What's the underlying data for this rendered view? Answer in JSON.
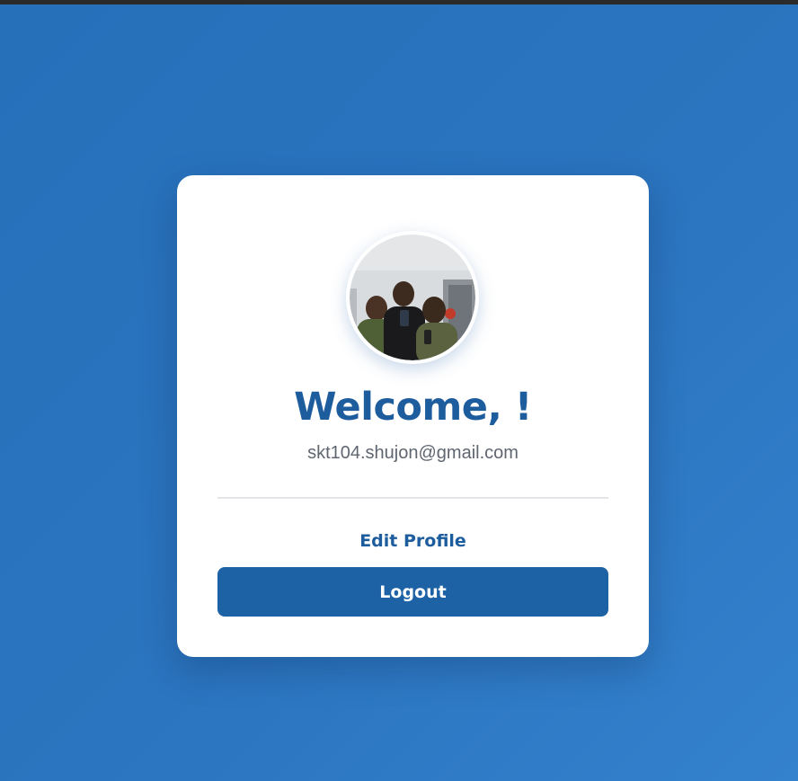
{
  "profile": {
    "avatar_icon": "profile-photo",
    "welcome_text": "Welcome, !",
    "email": "skt104.shujon@gmail.com",
    "edit_profile_label": "Edit Profile",
    "logout_label": "Logout"
  },
  "colors": {
    "background": "#2b74bf",
    "card": "#ffffff",
    "accent": "#1d5c9d",
    "button": "#1e62a6",
    "email_text": "#5f6670"
  }
}
